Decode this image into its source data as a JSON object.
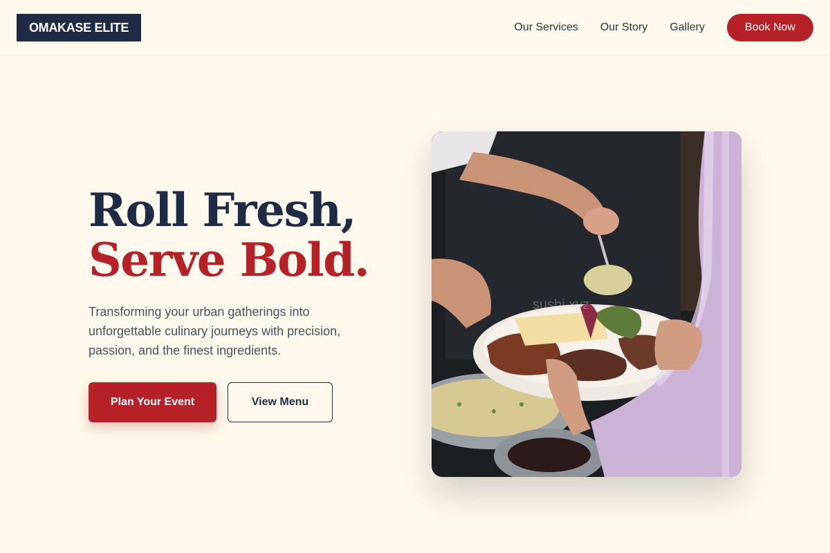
{
  "header": {
    "logo": "OMAKASE ELITE",
    "nav": [
      {
        "label": "Our Services"
      },
      {
        "label": "Our Story"
      },
      {
        "label": "Gallery"
      }
    ],
    "cta": "Book Now"
  },
  "hero": {
    "title_line1": "Roll Fresh,",
    "title_line2": "Serve Bold.",
    "description": "Transforming your urban gatherings into unforgettable culinary journeys with precision, passion, and the finest ingredients.",
    "primary_cta": "Plan Your Event",
    "secondary_cta": "View Menu",
    "image_watermark": "sushi.xyz"
  },
  "colors": {
    "background": "#fef9ec",
    "navy": "#1f2a44",
    "accent_red": "#b52126",
    "body_text": "#475060"
  }
}
